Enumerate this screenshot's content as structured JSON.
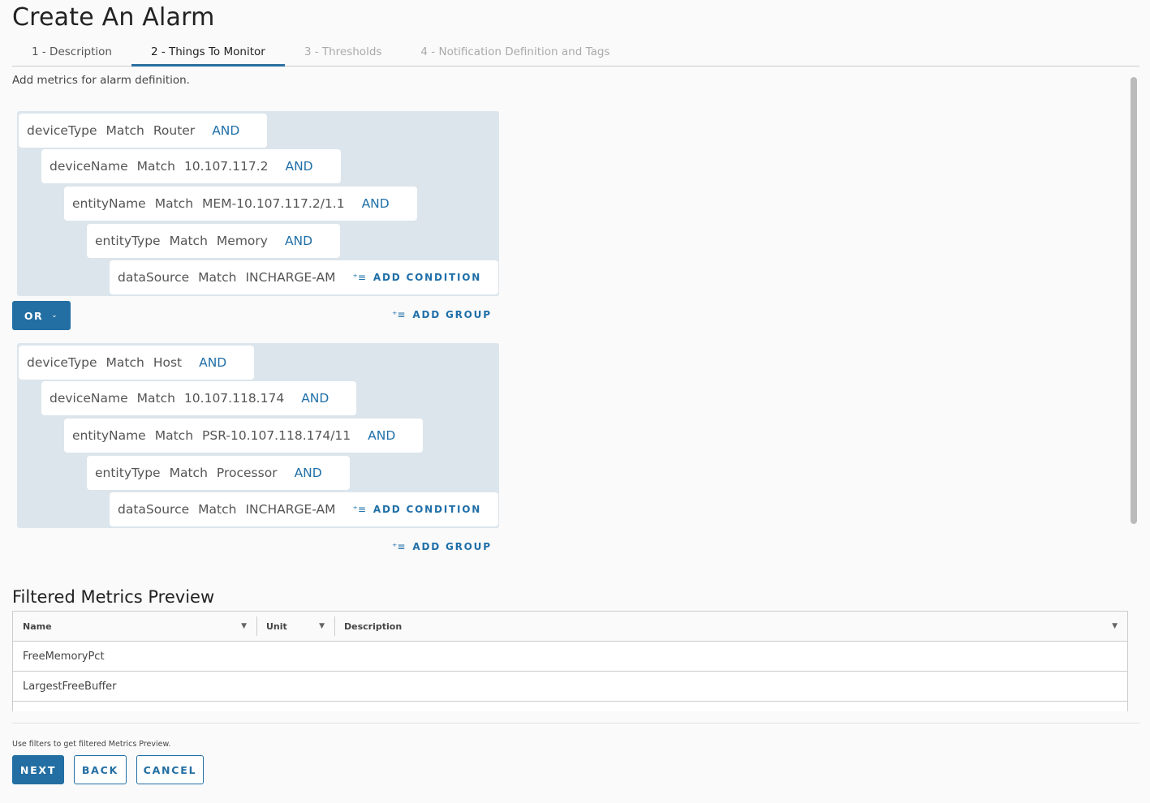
{
  "title": "Create An Alarm",
  "tabs": [
    {
      "label": "1 - Description",
      "state": "done"
    },
    {
      "label": "2 - Things To Monitor",
      "state": "active"
    },
    {
      "label": "3 - Thresholds",
      "state": "disabled"
    },
    {
      "label": "4 - Notification Definition and Tags",
      "state": "disabled"
    }
  ],
  "subtitle": "Add metrics for alarm definition.",
  "groups": [
    {
      "conditions": [
        {
          "field": "deviceType",
          "op": "Match",
          "value": "Router",
          "join": "AND"
        },
        {
          "field": "deviceName",
          "op": "Match",
          "value": "10.107.117.2",
          "join": "AND"
        },
        {
          "field": "entityName",
          "op": "Match",
          "value": "MEM-10.107.117.2/1.1",
          "join": "AND"
        },
        {
          "field": "entityType",
          "op": "Match",
          "value": "Memory",
          "join": "AND"
        },
        {
          "field": "dataSource",
          "op": "Match",
          "value": "INCHARGE-AM"
        }
      ]
    },
    {
      "conditions": [
        {
          "field": "deviceType",
          "op": "Match",
          "value": "Host",
          "join": "AND"
        },
        {
          "field": "deviceName",
          "op": "Match",
          "value": "10.107.118.174",
          "join": "AND"
        },
        {
          "field": "entityName",
          "op": "Match",
          "value": "PSR-10.107.118.174/11",
          "join": "AND"
        },
        {
          "field": "entityType",
          "op": "Match",
          "value": "Processor",
          "join": "AND"
        },
        {
          "field": "dataSource",
          "op": "Match",
          "value": "INCHARGE-AM"
        }
      ]
    }
  ],
  "add_condition": "ADD CONDITION",
  "add_group": "ADD GROUP",
  "group_operator": "OR",
  "preview": {
    "title": "Filtered Metrics Preview",
    "columns": [
      "Name",
      "Unit",
      "Description"
    ],
    "rows": [
      "FreeMemoryPct",
      "LargestFreeBuffer"
    ]
  },
  "hint": "Use filters to get filtered Metrics Preview.",
  "buttons": {
    "next": "NEXT",
    "back": "BACK",
    "cancel": "CANCEL"
  },
  "colors": {
    "accent": "#236fa3",
    "group_bg": "#dce5ec"
  }
}
